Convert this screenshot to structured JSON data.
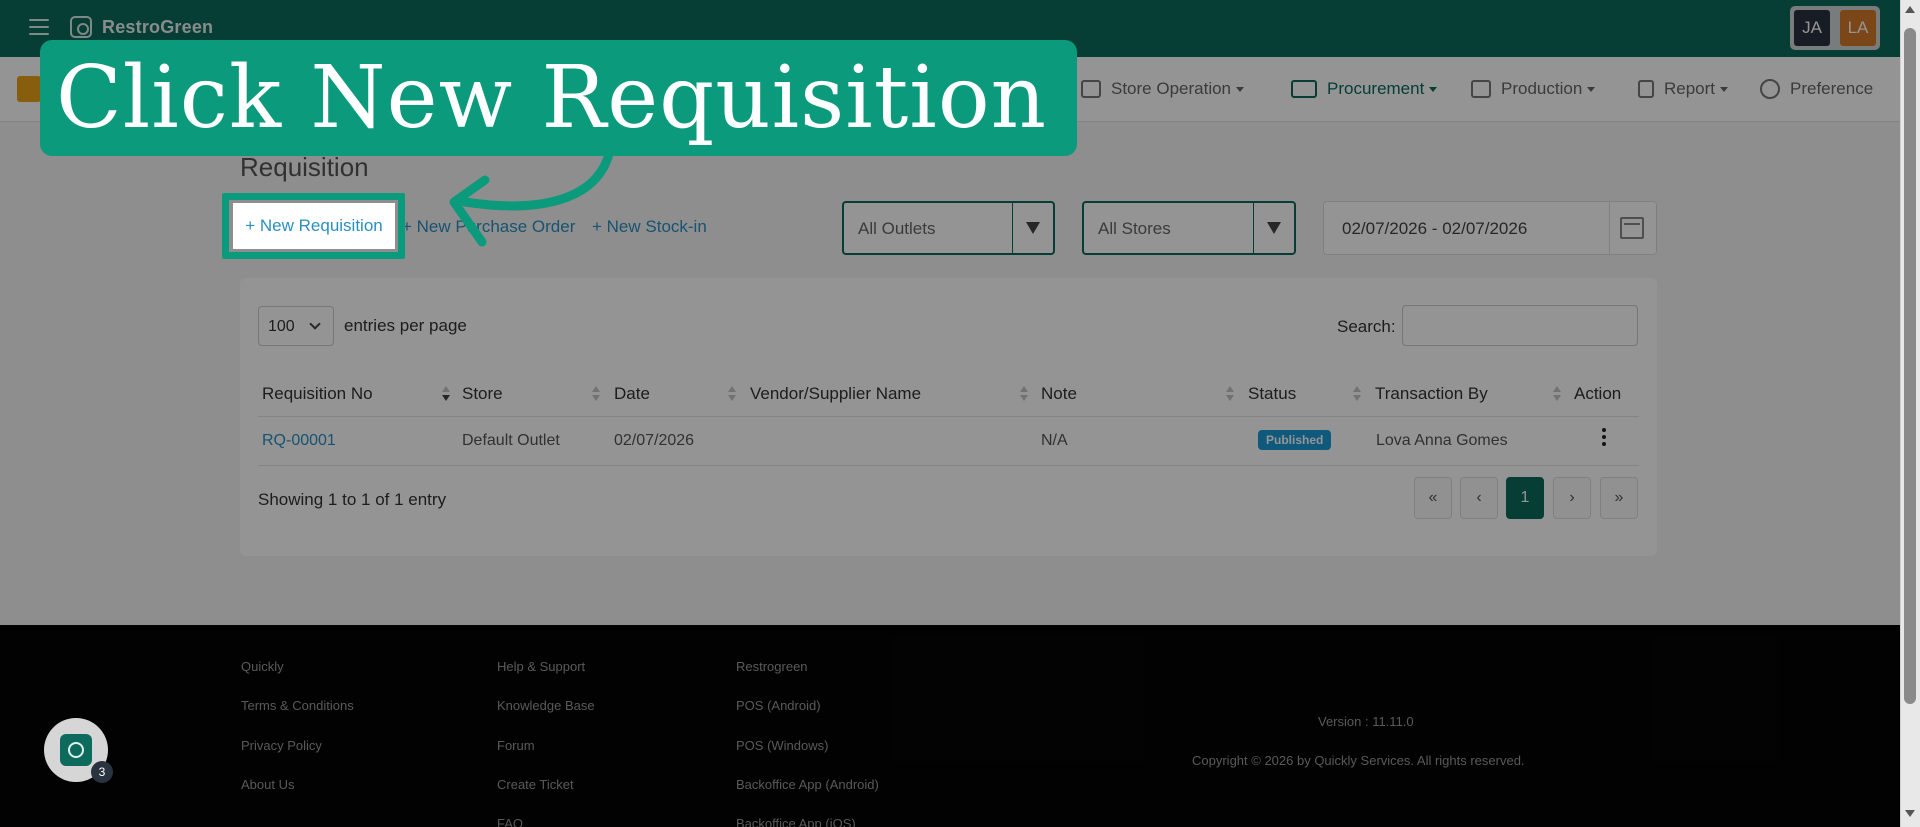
{
  "app": {
    "brand": "RestroGreen",
    "user_initials_1": "JA",
    "user_initials_2": "LA"
  },
  "colors": {
    "primary": "#0c6b5d",
    "accent": "#0c9a7c",
    "link": "#2a8fc2",
    "badge": "#1a9ad6",
    "avatar_ja": "#2a3340",
    "avatar_la": "#d67a2a"
  },
  "nav": {
    "items": [
      {
        "label": "Store Operation",
        "icon": "store-icon"
      },
      {
        "label": "Procurement",
        "icon": "procurement-icon",
        "active": true
      },
      {
        "label": "Production",
        "icon": "production-icon"
      },
      {
        "label": "Report",
        "icon": "clipboard-icon"
      },
      {
        "label": "Preference",
        "icon": "gear-icon"
      }
    ]
  },
  "page": {
    "title": "Requisition",
    "actions": {
      "new_requisition": "+ New Requisition",
      "new_purchase_order": "+ New Purchase Order",
      "new_stock_in": "+ New Stock-in"
    },
    "filters": {
      "outlet": "All Outlets",
      "store": "All Stores",
      "date_range": "02/07/2026 - 02/07/2026"
    }
  },
  "table": {
    "entries_value": "100",
    "entries_label": "entries per page",
    "search_label": "Search:",
    "columns": [
      "Requisition No",
      "Store",
      "Date",
      "Vendor/Supplier Name",
      "Note",
      "Status",
      "Transaction By",
      "Action"
    ],
    "rows": [
      {
        "requisition_no": "RQ-00001",
        "store": "Default Outlet",
        "date": "02/07/2026",
        "vendor": "",
        "note": "N/A",
        "status": "Published",
        "transaction_by": "Lova Anna Gomes"
      }
    ],
    "showing": "Showing 1 to 1 of 1 entry",
    "pagination": [
      "«",
      "‹",
      "1",
      "›",
      "»"
    ],
    "current_page": "1"
  },
  "footer": {
    "col1": [
      "Quickly",
      "Terms & Conditions",
      "Privacy Policy",
      "About Us"
    ],
    "col2": [
      "Help & Support",
      "Knowledge Base",
      "Forum",
      "Create Ticket",
      "FAQ"
    ],
    "col3": [
      "Restrogreen",
      "POS (Android)",
      "POS (Windows)",
      "Backoffice App (Android)",
      "Backoffice App (iOS)"
    ],
    "version": "Version : 11.11.0",
    "copyright": "Copyright © 2026 by Quickly Services. All rights reserved."
  },
  "fab": {
    "badge_count": "3"
  },
  "overlay": {
    "callout": "Click New Requisition",
    "highlight_label": "+ New Requisition"
  }
}
